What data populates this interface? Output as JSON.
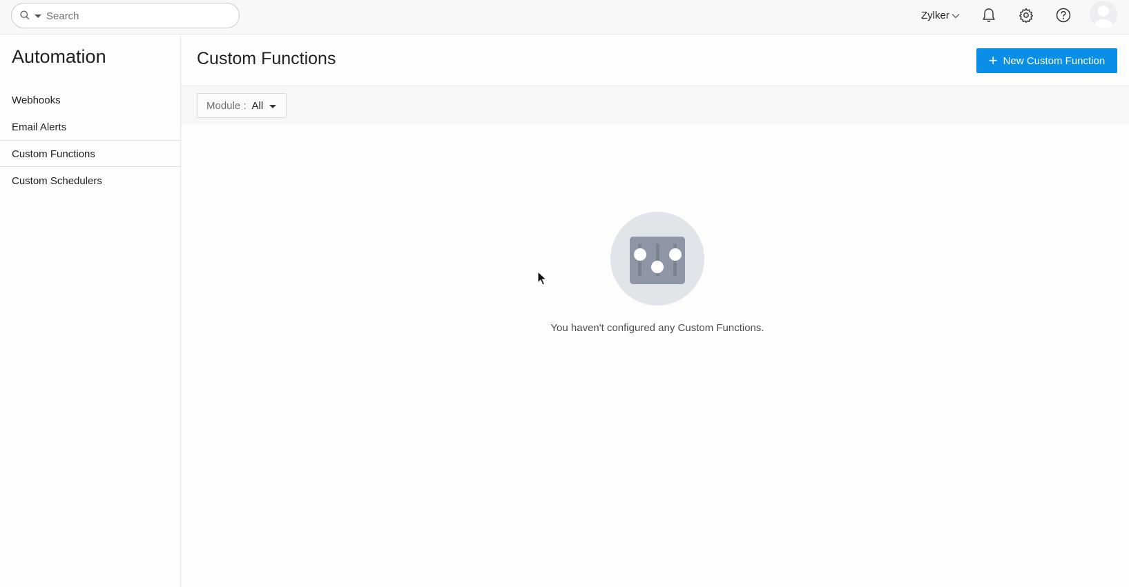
{
  "topbar": {
    "search_placeholder": "Search",
    "org_name": "Zylker",
    "icons": [
      "search-icon",
      "bell-icon",
      "gear-icon",
      "help-icon",
      "avatar"
    ]
  },
  "sidebar": {
    "title": "Automation",
    "items": [
      {
        "label": "Webhooks",
        "active": false
      },
      {
        "label": "Email Alerts",
        "active": false
      },
      {
        "label": "Custom Functions",
        "active": true
      },
      {
        "label": "Custom Schedulers",
        "active": false
      }
    ]
  },
  "main": {
    "title": "Custom Functions",
    "new_button_label": "New Custom Function",
    "filter": {
      "label": "Module :",
      "value": "All"
    },
    "empty_message": "You haven't configured any Custom Functions."
  },
  "colors": {
    "accent": "#0a8fe8",
    "illustration_bg": "#e1e4e9",
    "illustration_fg": "#8e96a5"
  }
}
